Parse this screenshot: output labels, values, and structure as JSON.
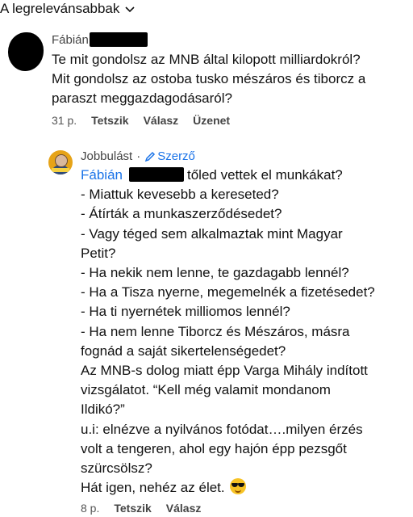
{
  "sort": {
    "label": "A legrelevánsabbak"
  },
  "comment1": {
    "author": "Fábián",
    "lines": [
      "Te mit gondolsz az MNB által kilopott milliardokról?",
      "Mit gondolsz az ostoba tusko mészáros és tiborcz a",
      "paraszt meggazdagodásaról?"
    ],
    "time": "31 p.",
    "like": "Tetszik",
    "reply": "Válasz",
    "message": "Üzenet"
  },
  "comment2": {
    "author": "Jobbulást",
    "separator": "·",
    "badge": "Szerző",
    "mention": "Fábián",
    "first_line_rest": "tőled vettek el munkákat?",
    "lines": [
      "- Miattuk kevesebb a kereseted?",
      "- Átírták a munkaszerződésedet?",
      "- Vagy téged sem alkalmaztak mint Magyar",
      "Petit?",
      "- Ha nekik nem lenne, te gazdagabb lennél?",
      "- Ha a Tisza nyerne, megemelnék a fizetésedet?",
      "- Ha ti nyernétek milliomos lennél?",
      "- Ha nem lenne Tiborcz és Mészáros, másra",
      "fognád a saját sikertelenségedet?",
      "Az MNB-s dolog miatt épp Varga Mihály indított",
      "vizsgálatot. “Kell még valamit mondanom",
      "Ildikó?”",
      "u.i: elnézve a nyilvános fotódat….milyen érzés",
      "volt a tengeren, ahol egy hajón épp pezsgőt",
      "szürcsölsz?"
    ],
    "last_line": "Hát igen, nehéz az élet.",
    "time": "8 p.",
    "like": "Tetszik",
    "reply": "Válasz"
  }
}
